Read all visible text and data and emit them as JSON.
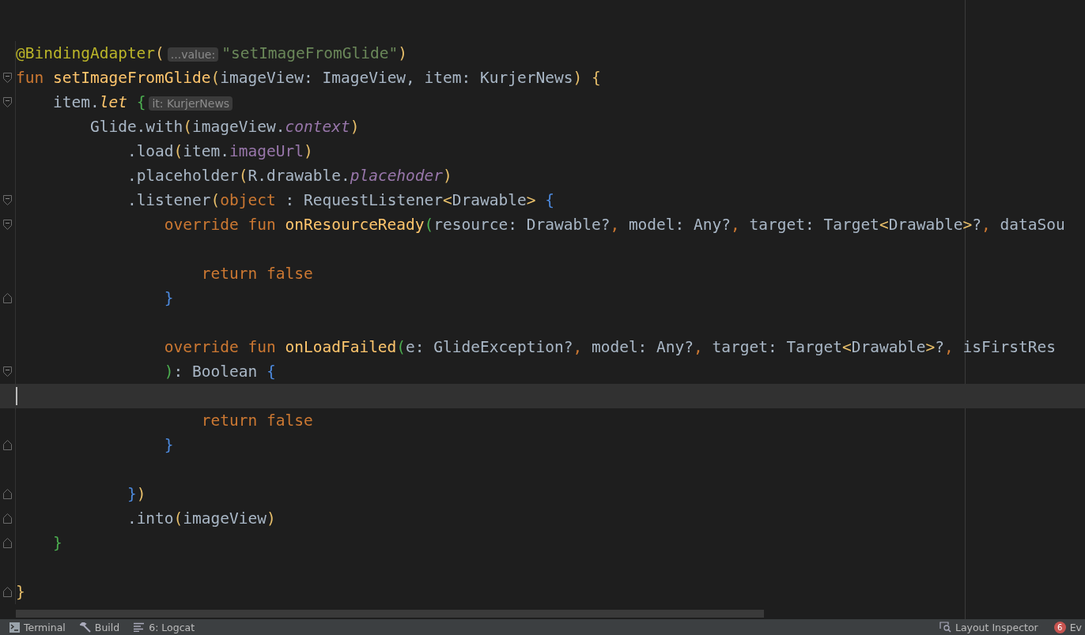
{
  "editor": {
    "lines": [
      {
        "kind": "plain",
        "tokens": [
          {
            "t": "@BindingAdapter",
            "kind": "ann"
          },
          {
            "t": "(",
            "kind": "y"
          },
          {
            "t": "...value:",
            "kind": "hint"
          },
          {
            "t": "\"setImageFromGlide\"",
            "kind": "str"
          },
          {
            "t": ")",
            "kind": "y"
          }
        ]
      },
      {
        "kind": "fold-start",
        "tokens": [
          {
            "t": "fun ",
            "kind": "kw"
          },
          {
            "t": "setImageFromGlide",
            "kind": "fn"
          },
          {
            "t": "(",
            "kind": "y"
          },
          {
            "t": "imageView: ImageView, item: KurjerNews",
            "kind": "plain"
          },
          {
            "t": ")",
            "kind": "y"
          },
          {
            "t": " {",
            "kind": "y"
          }
        ]
      },
      {
        "kind": "fold-start",
        "tokens": [
          {
            "t": "    item.",
            "kind": "plain"
          },
          {
            "t": "let",
            "kind": "fni"
          },
          {
            "t": " {",
            "kind": "g"
          },
          {
            "t": "it: KurjerNews",
            "kind": "hint"
          }
        ]
      },
      {
        "kind": "plain",
        "tokens": [
          {
            "t": "        Glide.with",
            "kind": "plain"
          },
          {
            "t": "(",
            "kind": "y"
          },
          {
            "t": "imageView.",
            "kind": "plain"
          },
          {
            "t": "context",
            "kind": "propi"
          },
          {
            "t": ")",
            "kind": "y"
          }
        ]
      },
      {
        "kind": "plain",
        "tokens": [
          {
            "t": "            .load",
            "kind": "plain"
          },
          {
            "t": "(",
            "kind": "y"
          },
          {
            "t": "item.",
            "kind": "plain"
          },
          {
            "t": "imageUrl",
            "kind": "prop"
          },
          {
            "t": ")",
            "kind": "y"
          }
        ]
      },
      {
        "kind": "plain",
        "tokens": [
          {
            "t": "            .placeholder",
            "kind": "plain"
          },
          {
            "t": "(",
            "kind": "y"
          },
          {
            "t": "R.drawable.",
            "kind": "plain"
          },
          {
            "t": "placehoder",
            "kind": "propi"
          },
          {
            "t": ")",
            "kind": "y"
          }
        ]
      },
      {
        "kind": "fold-start",
        "tokens": [
          {
            "t": "            .listener",
            "kind": "plain"
          },
          {
            "t": "(",
            "kind": "y"
          },
          {
            "t": "object",
            "kind": "kw"
          },
          {
            "t": " : RequestListener",
            "kind": "plain"
          },
          {
            "t": "<",
            "kind": "y"
          },
          {
            "t": "Drawable",
            "kind": "plain"
          },
          {
            "t": ">",
            "kind": "y"
          },
          {
            "t": " {",
            "kind": "b"
          }
        ]
      },
      {
        "kind": "fold-start",
        "tokens": [
          {
            "t": "                override fun ",
            "kind": "kw"
          },
          {
            "t": "onResourceReady",
            "kind": "fn"
          },
          {
            "t": "(",
            "kind": "g"
          },
          {
            "t": "resource: Drawable?",
            "kind": "plain"
          },
          {
            "t": ", ",
            "kind": "kw"
          },
          {
            "t": "model: Any?",
            "kind": "plain"
          },
          {
            "t": ", ",
            "kind": "kw"
          },
          {
            "t": "target: Target",
            "kind": "plain"
          },
          {
            "t": "<",
            "kind": "y"
          },
          {
            "t": "Drawable",
            "kind": "plain"
          },
          {
            "t": ">",
            "kind": "y"
          },
          {
            "t": "?",
            "kind": "plain"
          },
          {
            "t": ", ",
            "kind": "kw"
          },
          {
            "t": "dataSou",
            "kind": "plain"
          }
        ]
      },
      {
        "kind": "plain"
      },
      {
        "kind": "plain",
        "tokens": [
          {
            "t": "                    return false",
            "kind": "kw"
          }
        ]
      },
      {
        "kind": "fold-end",
        "tokens": [
          {
            "t": "                }",
            "kind": "b"
          }
        ]
      },
      {
        "kind": "plain"
      },
      {
        "kind": "plain",
        "tokens": [
          {
            "t": "                override fun ",
            "kind": "kw"
          },
          {
            "t": "onLoadFailed",
            "kind": "fn"
          },
          {
            "t": "(",
            "kind": "g"
          },
          {
            "t": "e: GlideException?",
            "kind": "plain"
          },
          {
            "t": ", ",
            "kind": "kw"
          },
          {
            "t": "model: Any?",
            "kind": "plain"
          },
          {
            "t": ", ",
            "kind": "kw"
          },
          {
            "t": "target: Target",
            "kind": "plain"
          },
          {
            "t": "<",
            "kind": "y"
          },
          {
            "t": "Drawable",
            "kind": "plain"
          },
          {
            "t": ">",
            "kind": "y"
          },
          {
            "t": "?",
            "kind": "plain"
          },
          {
            "t": ", ",
            "kind": "kw"
          },
          {
            "t": "isFirstRes",
            "kind": "plain"
          }
        ]
      },
      {
        "kind": "fold-start",
        "tokens": [
          {
            "t": "                )",
            "kind": "g"
          },
          {
            "t": ": Boolean ",
            "kind": "plain"
          },
          {
            "t": "{",
            "kind": "b"
          }
        ]
      },
      {
        "kind": "plain",
        "current": true
      },
      {
        "kind": "plain",
        "tokens": [
          {
            "t": "                    return false",
            "kind": "kw"
          }
        ]
      },
      {
        "kind": "fold-end",
        "tokens": [
          {
            "t": "                }",
            "kind": "b"
          }
        ]
      },
      {
        "kind": "plain"
      },
      {
        "kind": "fold-end",
        "tokens": [
          {
            "t": "            }",
            "kind": "b"
          },
          {
            "t": ")",
            "kind": "y"
          }
        ]
      },
      {
        "kind": "fold-end",
        "tokens": [
          {
            "t": "            .into",
            "kind": "plain"
          },
          {
            "t": "(",
            "kind": "y"
          },
          {
            "t": "imageView",
            "kind": "plain"
          },
          {
            "t": ")",
            "kind": "y"
          }
        ]
      },
      {
        "kind": "fold-end",
        "tokens": [
          {
            "t": "    }",
            "kind": "g"
          }
        ]
      },
      {
        "kind": "plain"
      },
      {
        "kind": "fold-end",
        "tokens": [
          {
            "t": "}",
            "kind": "y"
          }
        ]
      }
    ]
  },
  "status_bar": {
    "left": [
      {
        "label": "Terminal"
      },
      {
        "label": "Build"
      },
      {
        "label": "6: Logcat"
      }
    ],
    "right": [
      {
        "label": "Layout Inspector"
      },
      {
        "label": "Ev",
        "badge": "6"
      }
    ]
  }
}
